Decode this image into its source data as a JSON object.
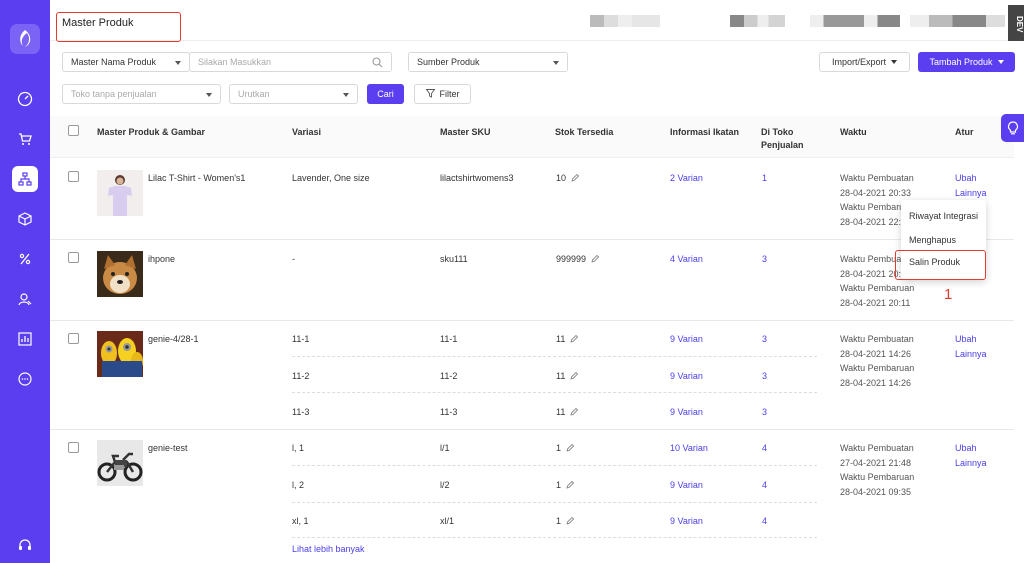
{
  "page_title": "Master Produk",
  "dev_label": "DEV",
  "filters": {
    "name_select": "Master Nama Produk",
    "search_placeholder": "Silakan Masukkan",
    "source_select": "Sumber Produk",
    "store_placeholder": "Toko tanpa penjualan",
    "sort_placeholder": "Urutkan",
    "search_button": "Cari",
    "filter_button": "Filter",
    "import_export": "Import/Export",
    "add_product": "Tambah Produk"
  },
  "columns": [
    "Master Produk & Gambar",
    "Variasi",
    "Master SKU",
    "Stok Tersedia",
    "Informasi Ikatan",
    "Di Toko Penjualan",
    "Waktu",
    "Atur"
  ],
  "labels": {
    "created": "Waktu Pembuatan",
    "updated": "Waktu Pembaruan",
    "edit": "Ubah",
    "more": "Lainnya",
    "see_more": "Lihat lebih banyak"
  },
  "products": [
    {
      "name": "Lilac T-Shirt - Women's1",
      "created": "28-04-2021 20:33",
      "updated": "28-04-2021 22:",
      "variants": [
        {
          "variasi": "Lavender, One size",
          "sku": "lilactshirtwomens3",
          "stock": "10",
          "binding": "2 Varian",
          "stores": "1"
        }
      ]
    },
    {
      "name": "ihpone",
      "created": "28-04-2021 20:",
      "updated": "28-04-2021 20:11",
      "variants": [
        {
          "variasi": "-",
          "sku": "sku111",
          "stock": "999999",
          "binding": "4 Varian",
          "stores": "3"
        }
      ]
    },
    {
      "name": "genie-4/28-1",
      "created": "28-04-2021 14:26",
      "updated": "28-04-2021 14:26",
      "variants": [
        {
          "variasi": "11-1",
          "sku": "11-1",
          "stock": "11",
          "binding": "9 Varian",
          "stores": "3"
        },
        {
          "variasi": "11-2",
          "sku": "11-2",
          "stock": "11",
          "binding": "9 Varian",
          "stores": "3"
        },
        {
          "variasi": "11-3",
          "sku": "11-3",
          "stock": "11",
          "binding": "9 Varian",
          "stores": "3"
        }
      ]
    },
    {
      "name": "genie-test",
      "created": "27-04-2021 21:48",
      "updated": "28-04-2021 09:35",
      "variants": [
        {
          "variasi": "l, 1",
          "sku": "l/1",
          "stock": "1",
          "binding": "10 Varian",
          "stores": "4"
        },
        {
          "variasi": "l, 2",
          "sku": "l/2",
          "stock": "1",
          "binding": "9 Varian",
          "stores": "4"
        },
        {
          "variasi": "xl, 1",
          "sku": "xl/1",
          "stock": "1",
          "binding": "9 Varian",
          "stores": "4"
        }
      ]
    }
  ],
  "dropdown_menu": [
    "Riwayat Integrasi",
    "Menghapus",
    "Salin Produk"
  ],
  "annotation": "1",
  "colors": {
    "brand": "#5b3ef0",
    "link": "#4a3ee8",
    "annotation": "#e23b2e"
  },
  "sidebar_icons": [
    "dashboard-icon",
    "cart-icon",
    "product-icon",
    "package-icon",
    "discount-icon",
    "customer-icon",
    "report-icon",
    "chat-icon",
    "support-icon"
  ]
}
